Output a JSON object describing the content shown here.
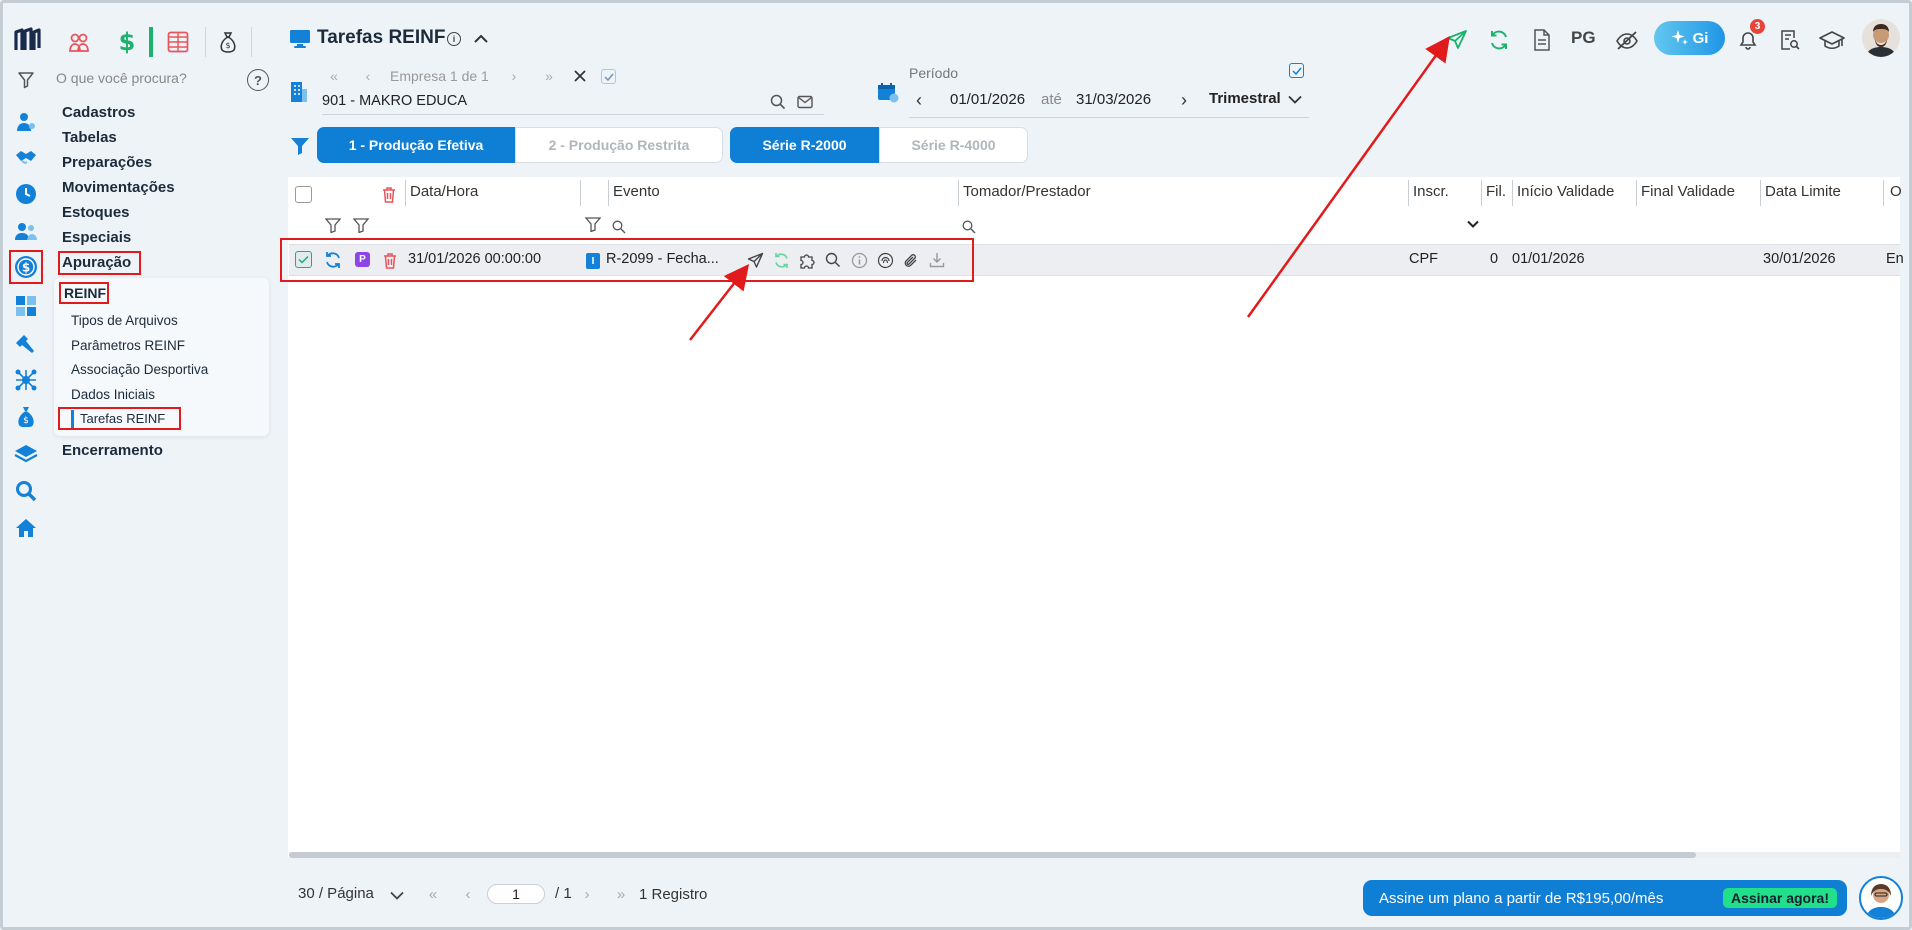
{
  "header": {
    "title": "Tarefas REINF",
    "gi_label": "Gi",
    "pg_label": "PG",
    "notification_count": "3"
  },
  "sidebar": {
    "search_placeholder": "O que você procura?",
    "help_label": "?",
    "menu": [
      {
        "label": "Cadastros"
      },
      {
        "label": "Tabelas"
      },
      {
        "label": "Preparações"
      },
      {
        "label": "Movimentações"
      },
      {
        "label": "Estoques"
      },
      {
        "label": "Especiais"
      },
      {
        "label": "Apuração"
      }
    ],
    "submenu_title": "REINF",
    "submenu": [
      {
        "label": "Tipos de Arquivos"
      },
      {
        "label": "Parâmetros REINF"
      },
      {
        "label": "Associação Desportiva"
      },
      {
        "label": "Dados Iniciais"
      },
      {
        "label": "Tarefas REINF"
      }
    ],
    "after_menu": "Encerramento"
  },
  "company": {
    "nav_label": "Empresa 1 de 1",
    "value": "901 - MAKRO EDUCA"
  },
  "period": {
    "label": "Período",
    "start": "01/01/2026",
    "separator": "até",
    "end": "31/03/2026",
    "type": "Trimestral"
  },
  "filters": {
    "production": [
      "1 - Produção Efetiva",
      "2 - Produção Restrita"
    ],
    "series": [
      "Série R-2000",
      "Série R-4000"
    ]
  },
  "grid": {
    "columns": [
      "Data/Hora",
      "Evento",
      "Tomador/Prestador",
      "Inscr.",
      "Fil.",
      "Início Validade",
      "Final Validade",
      "Data Limite",
      "O"
    ],
    "rows": [
      {
        "badge": "P",
        "event_badge": "I",
        "datetime": "31/01/2026 00:00:00",
        "event": "R-2099 - Fecha...",
        "inscr": "CPF",
        "fil": "0",
        "start": "01/01/2026",
        "end": "",
        "limit": "30/01/2026",
        "other": "En"
      }
    ]
  },
  "footer": {
    "page_size": "30 / Página",
    "page_input": "1",
    "page_total": "/ 1",
    "records": "1 Registro",
    "promo_text": "Assine um plano a partir de R$195,00/mês",
    "promo_button": "Assinar agora!"
  },
  "colors": {
    "primary": "#0f7fd6",
    "annotation_red": "#e11b1b",
    "green": "#1bb36b",
    "promo_green": "#22e08a"
  }
}
